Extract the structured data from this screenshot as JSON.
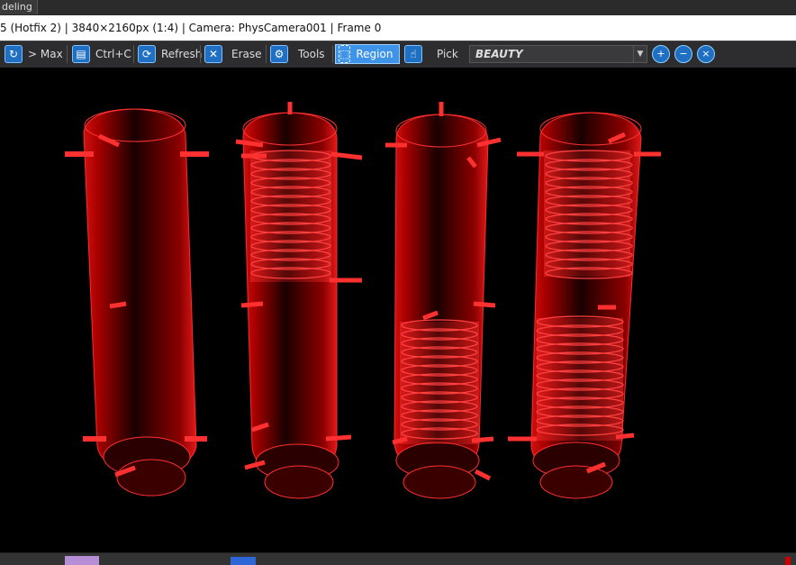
{
  "app": {
    "tab_label": "deling"
  },
  "title": {
    "text": "5 (Hotfix 2) | 3840×2160px (1:4) | Camera: PhysCamera001 | Frame 0"
  },
  "toolbar": {
    "buttons": [
      {
        "label": "> Max",
        "icon": "reload-icon"
      },
      {
        "label": "Ctrl+C",
        "icon": "copy-icon"
      },
      {
        "label": "Refresh",
        "icon": "refresh-icon"
      },
      {
        "label": "Erase",
        "icon": "erase-x-icon"
      },
      {
        "label": "Tools",
        "icon": "gear-icon"
      },
      {
        "label": "Region",
        "icon": "region-select-icon",
        "active": true
      },
      {
        "label": "Pick",
        "icon": "hand-pointer-icon"
      }
    ],
    "render_channel": "BEAUTY",
    "zoom_icons": [
      "zoom-in-icon",
      "zoom-out-icon",
      "zoom-fit-icon"
    ]
  },
  "viewport": {
    "content": "wireframe render of four vertical water tanks",
    "tank_count": 4
  },
  "colors": {
    "accent": "#3e94e8",
    "wire": "#ff1a1a",
    "toolbar": "#2d2d30",
    "viewport": "#000000"
  }
}
